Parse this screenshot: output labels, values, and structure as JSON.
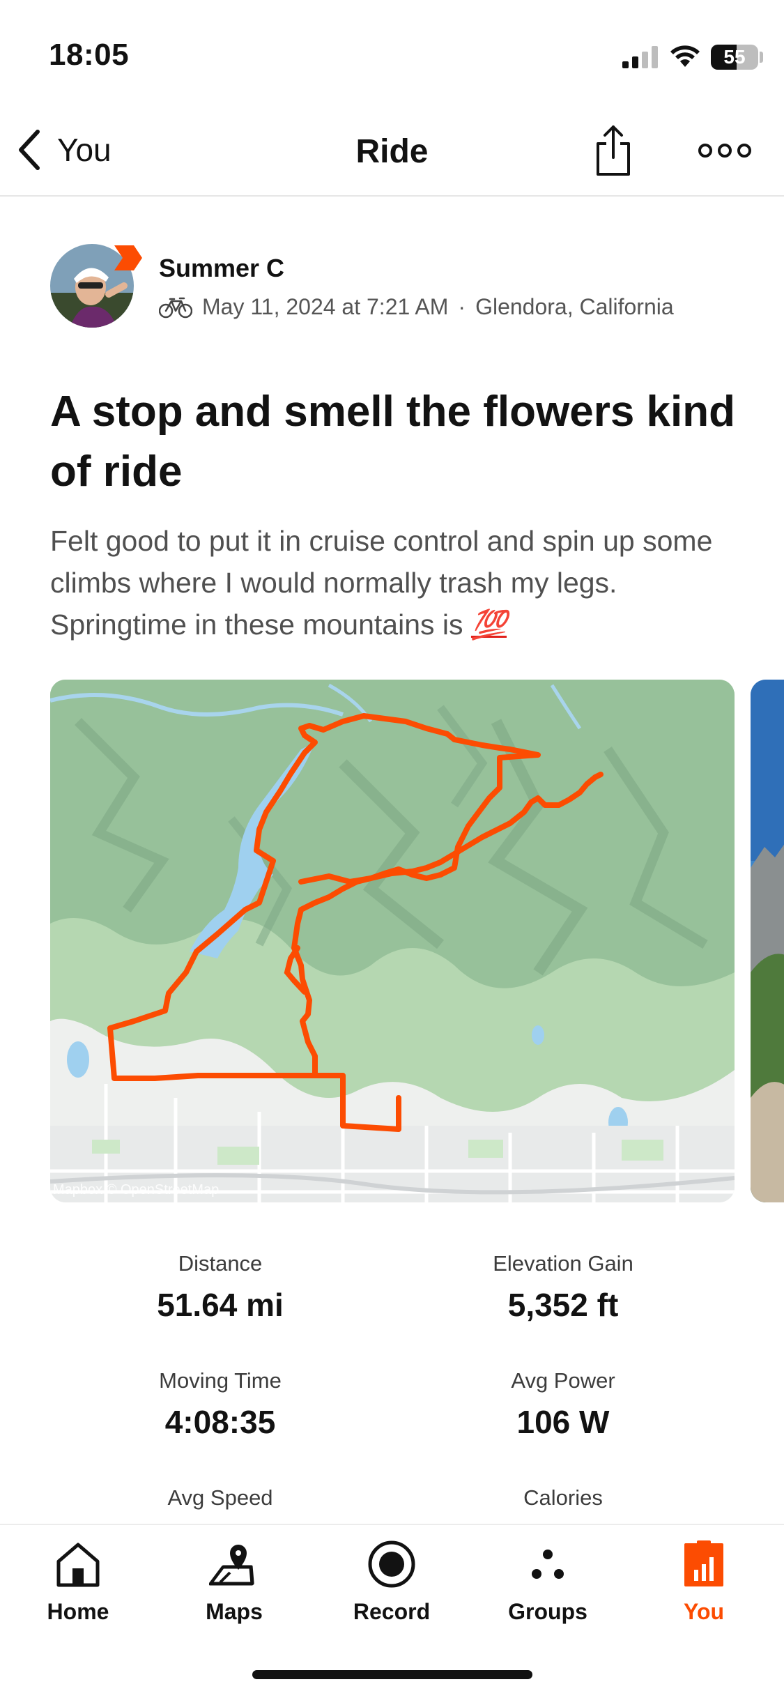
{
  "status_bar": {
    "time": "18:05",
    "battery": "55",
    "battery_level": 0.55
  },
  "nav": {
    "back_label": "You",
    "title": "Ride",
    "back_icon": "chevron-left-icon",
    "share_icon": "share-icon",
    "more_icon": "more-icon"
  },
  "activity": {
    "athlete_name": "Summer C",
    "activity_type_icon": "bike-icon",
    "date": "May 11, 2024 at 7:21 AM",
    "separator": "·",
    "location": "Glendora, California",
    "title": "A stop and smell the flowers kind of ride",
    "description": "Felt good to put it in cruise control and spin up some climbs where I would normally trash my legs.  Springtime in these mountains is",
    "description_emoji": "💯",
    "map_attribution": "Mapbox © OpenStreetMap",
    "route_color": "#fc4c02"
  },
  "stats": [
    {
      "label": "Distance",
      "value": "51.64 mi"
    },
    {
      "label": "Elevation Gain",
      "value": "5,352 ft"
    },
    {
      "label": "Moving Time",
      "value": "4:08:35"
    },
    {
      "label": "Avg Power",
      "value": "106 W"
    },
    {
      "label": "Avg Speed",
      "value": ""
    },
    {
      "label": "Calories",
      "value": ""
    }
  ],
  "tabs": [
    {
      "label": "Home",
      "icon": "home-icon",
      "active": false
    },
    {
      "label": "Maps",
      "icon": "maps-icon",
      "active": false
    },
    {
      "label": "Record",
      "icon": "record-icon",
      "active": false
    },
    {
      "label": "Groups",
      "icon": "groups-icon",
      "active": false
    },
    {
      "label": "You",
      "icon": "you-icon",
      "active": true
    }
  ],
  "colors": {
    "accent": "#fc4c02",
    "text": "#121212",
    "muted": "#505050"
  }
}
